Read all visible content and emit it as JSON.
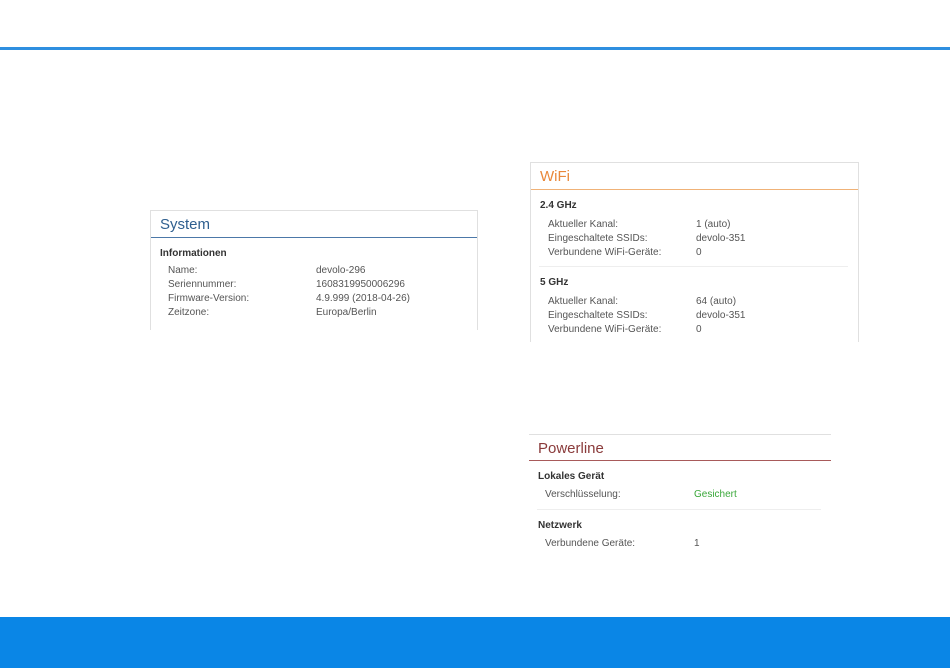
{
  "colors": {
    "accent_blue": "#2e8fe0",
    "footer_blue": "#0a86e6",
    "system_title": "#2f5f8f",
    "wifi_title": "#e9883a",
    "powerline_title": "#8a3b3b",
    "status_green": "#3aa83a"
  },
  "system": {
    "title": "System",
    "section": "Informationen",
    "rows": [
      {
        "label": "Name:",
        "value": "devolo-296"
      },
      {
        "label": "Seriennummer:",
        "value": "1608319950006296"
      },
      {
        "label": "Firmware-Version:",
        "value": "4.9.999 (2018-04-26)"
      },
      {
        "label": "Zeitzone:",
        "value": "Europa/Berlin"
      }
    ]
  },
  "wifi": {
    "title": "WiFi",
    "bands": [
      {
        "name": "2.4 GHz",
        "rows": [
          {
            "label": "Aktueller Kanal:",
            "value": "1 (auto)"
          },
          {
            "label": "Eingeschaltete SSIDs:",
            "value": "devolo-351"
          },
          {
            "label": "Verbundene WiFi-Geräte:",
            "value": "0"
          }
        ]
      },
      {
        "name": "5 GHz",
        "rows": [
          {
            "label": "Aktueller Kanal:",
            "value": "64 (auto)"
          },
          {
            "label": "Eingeschaltete SSIDs:",
            "value": "devolo-351"
          },
          {
            "label": "Verbundene WiFi-Geräte:",
            "value": "0"
          }
        ]
      }
    ]
  },
  "powerline": {
    "title": "Powerline",
    "local": {
      "name": "Lokales Gerät",
      "rows": [
        {
          "label": "Verschlüsselung:",
          "value": "Gesichert"
        }
      ]
    },
    "network": {
      "name": "Netzwerk",
      "rows": [
        {
          "label": "Verbundene Geräte:",
          "value": "1"
        }
      ]
    }
  }
}
